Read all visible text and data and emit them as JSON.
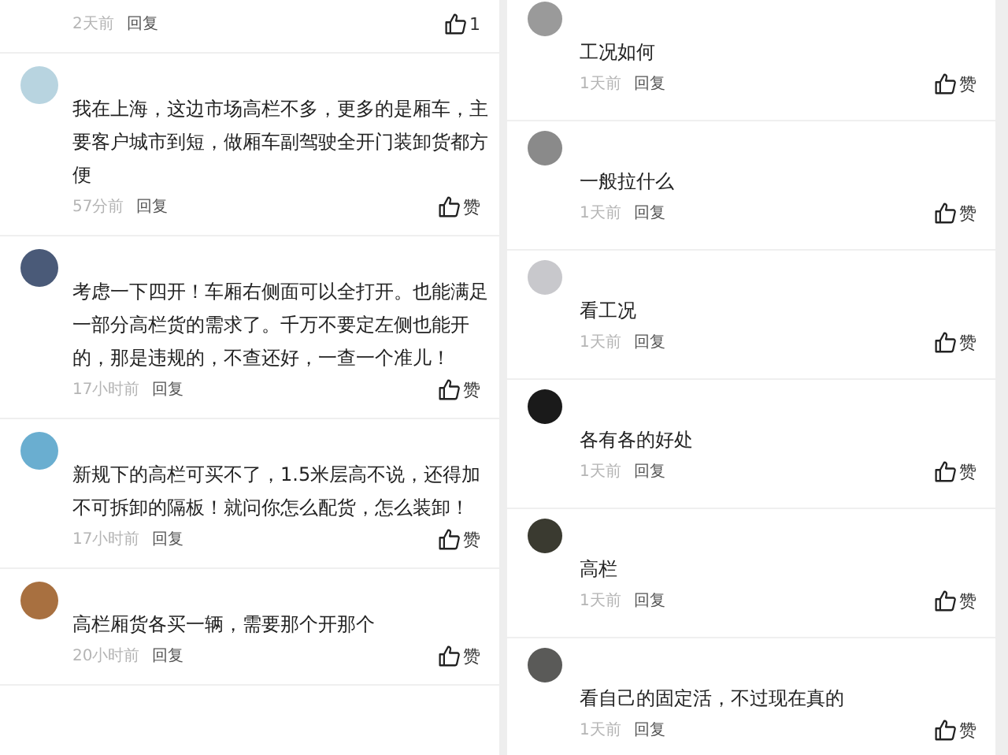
{
  "columns": [
    {
      "comments": [
        {
          "time": "2天前",
          "reply": "回复",
          "likes": "1"
        },
        {
          "color": "#b8d4e0",
          "text": "我在上海，这边市场高栏不多，更多的是厢车，主要客户城市到短，做厢车副驾驶全开门装卸货都方便",
          "time": "57分前",
          "reply": "回复",
          "likes": "赞"
        },
        {
          "color": "#4a5a78",
          "text": "考虑一下四开！车厢右侧面可以全打开。也能满足一部分高栏货的需求了。千万不要定左侧也能开的，那是违规的，不查还好，一查一个准儿！",
          "time": "17小时前",
          "reply": "回复",
          "likes": "赞"
        },
        {
          "color": "#6aaed0",
          "text": "新规下的高栏可买不了，1.5米层高不说，还得加不可拆卸的隔板！就问你怎么配货，怎么装卸！",
          "time": "17小时前",
          "reply": "回复",
          "likes": "赞"
        },
        {
          "color": "#a87040",
          "text": "高栏厢货各买一辆，需要那个开那个",
          "time": "20小时前",
          "reply": "回复",
          "likes": "赞"
        }
      ]
    },
    {
      "comments": [
        {
          "color": "#9a9a9a",
          "text": "工况如何",
          "time": "1天前",
          "reply": "回复",
          "likes": "赞"
        },
        {
          "color": "#8a8a8a",
          "text": "一般拉什么",
          "time": "1天前",
          "reply": "回复",
          "likes": "赞"
        },
        {
          "color": "#c8c8cc",
          "text": "看工况",
          "time": "1天前",
          "reply": "回复",
          "likes": "赞"
        },
        {
          "color": "#1a1a1a",
          "text": "各有各的好处",
          "time": "1天前",
          "reply": "回复",
          "likes": "赞"
        },
        {
          "color": "#3a3a30",
          "text": "高栏",
          "time": "1天前",
          "reply": "回复",
          "likes": "赞"
        },
        {
          "color": "#5a5a58",
          "text": "看自己的固定活，不过现在真的",
          "time": "1天前",
          "reply": "回复",
          "likes": "赞"
        }
      ]
    }
  ]
}
